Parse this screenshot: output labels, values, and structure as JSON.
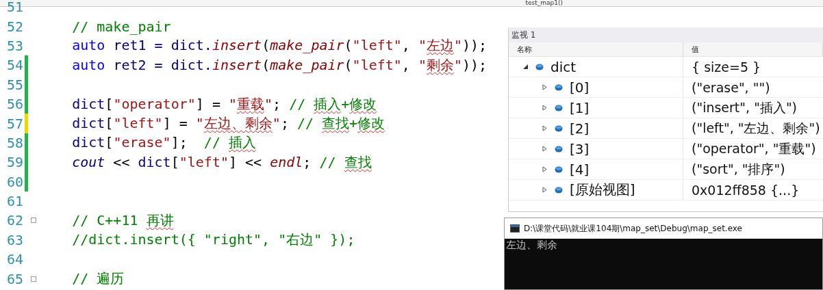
{
  "nav_bar": {
    "function_scope": "test_map1()"
  },
  "editor": {
    "lines": [
      {
        "number": "51",
        "changed": false,
        "unsaved": false,
        "fold": false
      },
      {
        "number": "52",
        "changed": false,
        "unsaved": false,
        "fold": false,
        "segments": [
          {
            "kind": "comment",
            "text": "    // make_pair"
          }
        ]
      },
      {
        "number": "53",
        "changed": false,
        "unsaved": false,
        "fold": false,
        "segments": [
          {
            "kind": "keyword",
            "text": "    auto "
          },
          {
            "kind": "ident",
            "text": "ret1 = dict."
          },
          {
            "kind": "func",
            "text": "insert"
          },
          {
            "kind": "plain",
            "text": "("
          },
          {
            "kind": "func",
            "text": "make_pair"
          },
          {
            "kind": "plain",
            "text": "("
          },
          {
            "kind": "string",
            "text": "\"left\""
          },
          {
            "kind": "plain",
            "text": ", "
          },
          {
            "kind": "string",
            "text": "\""
          },
          {
            "kind": "string",
            "text": "左边",
            "squiggle": true
          },
          {
            "kind": "string",
            "text": "\""
          },
          {
            "kind": "plain",
            "text": "));"
          }
        ]
      },
      {
        "number": "54",
        "changed": true,
        "unsaved": false,
        "fold": false,
        "segments": [
          {
            "kind": "keyword",
            "text": "    auto "
          },
          {
            "kind": "ident",
            "text": "ret2 = dict."
          },
          {
            "kind": "func",
            "text": "insert"
          },
          {
            "kind": "plain",
            "text": "("
          },
          {
            "kind": "func",
            "text": "make_pair"
          },
          {
            "kind": "plain",
            "text": "("
          },
          {
            "kind": "string",
            "text": "\"left\""
          },
          {
            "kind": "plain",
            "text": ", "
          },
          {
            "kind": "string",
            "text": "\""
          },
          {
            "kind": "string",
            "text": "剩余",
            "squiggle": true
          },
          {
            "kind": "string",
            "text": "\""
          },
          {
            "kind": "plain",
            "text": "));"
          }
        ]
      },
      {
        "number": "55",
        "changed": true,
        "unsaved": false,
        "fold": false
      },
      {
        "number": "56",
        "changed": true,
        "unsaved": false,
        "fold": false,
        "segments": [
          {
            "kind": "ident",
            "text": "    dict"
          },
          {
            "kind": "plain",
            "text": "["
          },
          {
            "kind": "string",
            "text": "\"operator\""
          },
          {
            "kind": "plain",
            "text": "] = "
          },
          {
            "kind": "string",
            "text": "\""
          },
          {
            "kind": "string",
            "text": "重载",
            "squiggle": true
          },
          {
            "kind": "string",
            "text": "\""
          },
          {
            "kind": "plain",
            "text": "; "
          },
          {
            "kind": "comment",
            "text": "// "
          },
          {
            "kind": "comment",
            "text": "插入",
            "squiggle": true
          },
          {
            "kind": "comment",
            "text": "+"
          },
          {
            "kind": "comment",
            "text": "修改",
            "squiggle": true
          }
        ]
      },
      {
        "number": "57",
        "changed": true,
        "unsaved": true,
        "fold": false,
        "segments": [
          {
            "kind": "ident",
            "text": "    dict"
          },
          {
            "kind": "plain",
            "text": "["
          },
          {
            "kind": "string",
            "text": "\"left\""
          },
          {
            "kind": "plain",
            "text": "] = "
          },
          {
            "kind": "string",
            "text": "\""
          },
          {
            "kind": "string",
            "text": "左边、剩余",
            "squiggle": true
          },
          {
            "kind": "string",
            "text": "\""
          },
          {
            "kind": "plain",
            "text": "; "
          },
          {
            "kind": "comment",
            "text": "// "
          },
          {
            "kind": "comment",
            "text": "查找",
            "squiggle": true
          },
          {
            "kind": "comment",
            "text": "+"
          },
          {
            "kind": "comment",
            "text": "修改",
            "squiggle": true
          }
        ]
      },
      {
        "number": "58",
        "changed": true,
        "unsaved": false,
        "fold": false,
        "segments": [
          {
            "kind": "ident",
            "text": "    dict"
          },
          {
            "kind": "plain",
            "text": "["
          },
          {
            "kind": "string",
            "text": "\"erase\""
          },
          {
            "kind": "plain",
            "text": "];  "
          },
          {
            "kind": "comment",
            "text": "// "
          },
          {
            "kind": "comment",
            "text": "插入",
            "squiggle": true
          }
        ]
      },
      {
        "number": "59",
        "changed": true,
        "unsaved": false,
        "fold": false,
        "segments": [
          {
            "kind": "stream",
            "text": "    cout"
          },
          {
            "kind": "plain",
            "text": " << "
          },
          {
            "kind": "ident",
            "text": "dict"
          },
          {
            "kind": "plain",
            "text": "["
          },
          {
            "kind": "string",
            "text": "\"left\""
          },
          {
            "kind": "plain",
            "text": "] << "
          },
          {
            "kind": "func",
            "text": "endl"
          },
          {
            "kind": "plain",
            "text": "; "
          },
          {
            "kind": "comment",
            "text": "// "
          },
          {
            "kind": "comment",
            "text": "查找",
            "squiggle": true
          }
        ]
      },
      {
        "number": "60",
        "changed": true,
        "unsaved": false,
        "fold": false
      },
      {
        "number": "61",
        "changed": false,
        "unsaved": false,
        "fold": false
      },
      {
        "number": "62",
        "changed": false,
        "unsaved": false,
        "fold": true,
        "segments": [
          {
            "kind": "comment",
            "text": "    // C++11 "
          },
          {
            "kind": "comment",
            "text": "再讲",
            "squiggle": true
          }
        ]
      },
      {
        "number": "63",
        "changed": false,
        "unsaved": false,
        "fold": false,
        "segments": [
          {
            "kind": "comment",
            "text": "    //dict.insert({ \"right\", \"右边\" });"
          }
        ]
      },
      {
        "number": "64",
        "changed": false,
        "unsaved": false,
        "fold": false
      },
      {
        "number": "65",
        "changed": false,
        "unsaved": false,
        "fold": true,
        "segments": [
          {
            "kind": "comment",
            "text": "    // 遍历"
          }
        ]
      }
    ]
  },
  "watch_panel": {
    "title": "监视 1",
    "columns": [
      "名称",
      "值"
    ],
    "rows": [
      {
        "name": "dict",
        "value": "{ size=5 }",
        "expanded": true,
        "children": [
          {
            "name": "[0]",
            "value": "(\"erase\", \"\")",
            "expanded": false
          },
          {
            "name": "[1]",
            "value": "(\"insert\", \"插入\")",
            "expanded": false
          },
          {
            "name": "[2]",
            "value": "(\"left\", \"左边、剩余\")",
            "expanded": false
          },
          {
            "name": "[3]",
            "value": "(\"operator\", \"重载\")",
            "expanded": false
          },
          {
            "name": "[4]",
            "value": "(\"sort\", \"排序\")",
            "expanded": false
          },
          {
            "name": "[原始视图]",
            "value": "0x012ff858 {...}",
            "expanded": false
          }
        ]
      }
    ]
  },
  "console": {
    "title": "D:\\课堂代码\\就业课104期\\map_set\\Debug\\map_set.exe",
    "output": "左边、剩余"
  }
}
